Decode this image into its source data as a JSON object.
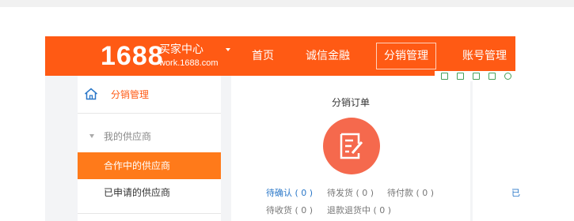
{
  "header": {
    "logo_number": "1688",
    "logo_title": "买家中心",
    "logo_domain": "work.1688.com",
    "nav": [
      {
        "label": "首页"
      },
      {
        "label": "诚信金融"
      },
      {
        "label": "分销管理",
        "active": true
      },
      {
        "label": "账号管理"
      }
    ]
  },
  "toolbar_icons": [
    "copy-icon",
    "expand-icon",
    "save-icon",
    "export-icon",
    "settings-icon"
  ],
  "sidebar": {
    "head_label": "分销管理",
    "group_label": "我的供应商",
    "items": [
      {
        "label": "合作中的供应商",
        "active": true
      },
      {
        "label": "已申请的供应商",
        "active": false
      }
    ]
  },
  "orders": {
    "title": "分销订单",
    "status_row1": [
      {
        "label": "待确认",
        "count": "( 0 )",
        "highlight": true
      },
      {
        "label": "待发货",
        "count": "( 0 )",
        "highlight": false
      },
      {
        "label": "待付款",
        "count": "( 0 )",
        "highlight": false
      }
    ],
    "status_row2": [
      {
        "label": "待收货",
        "count": "( 0 )",
        "highlight": false
      },
      {
        "label": "退款退货中",
        "count": "( 0 )",
        "highlight": false
      }
    ]
  },
  "card2": {
    "text": "已"
  },
  "colors": {
    "brand": "#ff5a14",
    "sidebar_active": "#ff7a1a",
    "order_circle": "#f5694d",
    "link": "#2a77c8"
  }
}
